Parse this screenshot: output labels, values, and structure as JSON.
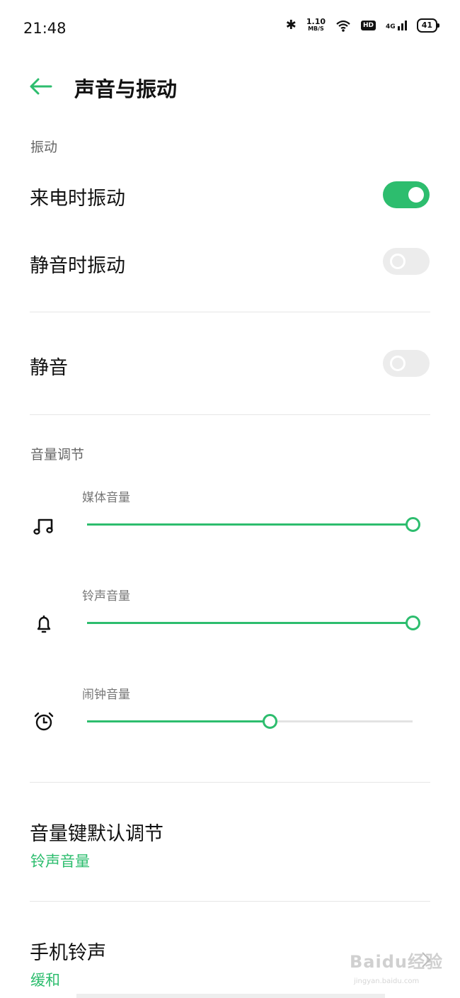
{
  "status": {
    "time": "21:48",
    "speed_value": "1.10",
    "speed_unit": "MB/S",
    "hd": "HD",
    "network": "4G",
    "battery": "41"
  },
  "header": {
    "title": "声音与振动"
  },
  "vibration": {
    "section_label": "振动",
    "ring_vibrate": {
      "label": "来电时振动",
      "on": true
    },
    "silent_vibrate": {
      "label": "静音时振动",
      "on": false
    }
  },
  "mute": {
    "label": "静音",
    "on": false
  },
  "volume": {
    "section_label": "音量调节",
    "media": {
      "label": "媒体音量",
      "level": 1.0,
      "icon": "music-note-icon"
    },
    "ringtone": {
      "label": "铃声音量",
      "level": 1.0,
      "icon": "bell-icon"
    },
    "alarm": {
      "label": "闹钟音量",
      "level": 0.56,
      "icon": "alarm-clock-icon"
    }
  },
  "volume_key": {
    "label": "音量键默认调节",
    "value": "铃声音量"
  },
  "ringtone": {
    "label": "手机铃声",
    "value": "缓和"
  },
  "watermark": {
    "text": "Baidu经验",
    "sub": "jingyan.baidu.com"
  },
  "colors": {
    "accent": "#2dbd6e",
    "toggle_off": "#ececec"
  }
}
